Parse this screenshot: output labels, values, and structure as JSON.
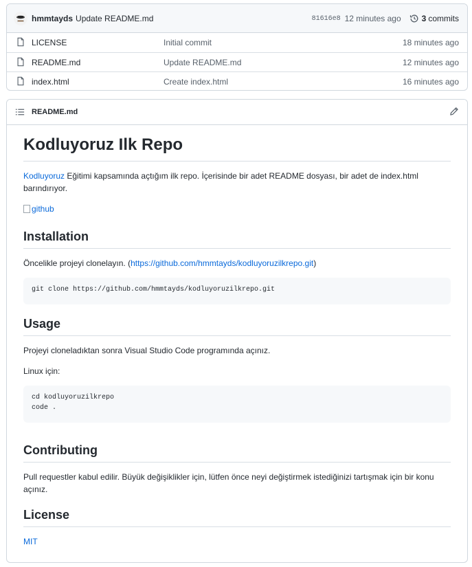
{
  "commit": {
    "author": "hmmtayds",
    "message": "Update README.md",
    "sha": "81616e8",
    "time": "12 minutes ago",
    "commit_count": "3",
    "commits_label": "commits"
  },
  "files": [
    {
      "name": "LICENSE",
      "commit": "Initial commit",
      "age": "18 minutes ago"
    },
    {
      "name": "README.md",
      "commit": "Update README.md",
      "age": "12 minutes ago"
    },
    {
      "name": "index.html",
      "commit": "Create index.html",
      "age": "16 minutes ago"
    }
  ],
  "readme": {
    "filename": "README.md",
    "title": "Kodluyoruz Ilk Repo",
    "intro_link": "Kodluyoruz",
    "intro_text": " Eğitimi kapsamında açtığım ilk repo. İçerisinde bir adet README dosyası, bir adet de index.html barındırıyor.",
    "image_alt": "github",
    "installation": {
      "heading": "Installation",
      "text_before": "Öncelikle projeyi clonelayın. (",
      "link": "https://github.com/hmmtayds/kodluyoruzilkrepo.git",
      "text_after": ")",
      "code": "git clone https://github.com/hmmtayds/kodluyoruzilkrepo.git"
    },
    "usage": {
      "heading": "Usage",
      "text": "Projeyi cloneladıktan sonra Visual Studio Code programında açınız.",
      "linux_label": "Linux için:",
      "code": "cd kodluyoruzilkrepo\ncode ."
    },
    "contributing": {
      "heading": "Contributing",
      "text": "Pull requestler kabul edilir. Büyük değişiklikler için, lütfen önce neyi değiştirmek istediğinizi tartışmak için bir konu açınız."
    },
    "license": {
      "heading": "License",
      "link": "MIT"
    }
  },
  "icons": {
    "file": "file-icon",
    "history": "history-icon",
    "list": "list-unordered-icon",
    "edit": "pencil-icon",
    "avatar": "user-avatar"
  },
  "colors": {
    "link": "#0969da",
    "border": "#d0d7de",
    "header_bg": "#f6f8fa",
    "muted": "#57606a"
  }
}
